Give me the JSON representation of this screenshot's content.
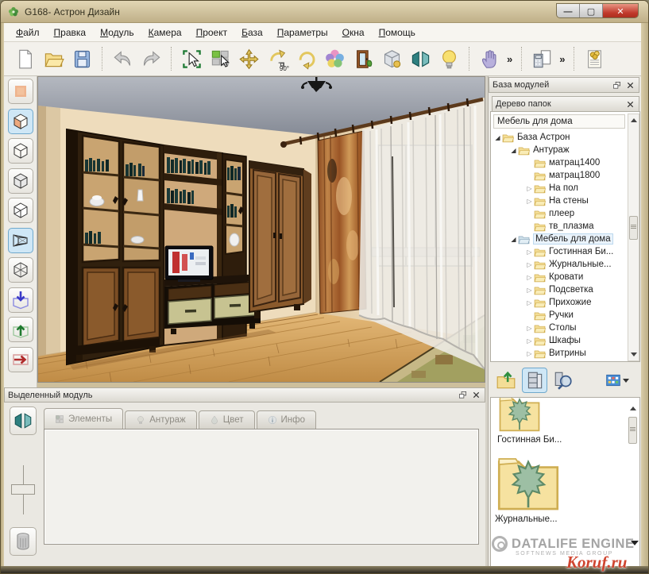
{
  "window": {
    "title": "G168- Астрон Дизайн",
    "app_icon": "astron-flower-icon",
    "controls": [
      "minimize",
      "maximize",
      "close"
    ]
  },
  "menu": {
    "items": [
      "Файл",
      "Правка",
      "Модуль",
      "Камера",
      "Проект",
      "База",
      "Параметры",
      "Окна",
      "Помощь"
    ]
  },
  "main_toolbar": {
    "rotate90_label": "90°",
    "groups": [
      [
        "new-document",
        "open-folder",
        "save-file"
      ],
      [
        "undo",
        "redo"
      ],
      [
        "select",
        "multi-select",
        "move",
        "rotate-90",
        "rotate-free",
        "colors",
        "material-door",
        "texture",
        "mirror-view",
        "light"
      ],
      [
        "pan-hand",
        "»"
      ],
      [
        "calculator-report",
        "»"
      ],
      [
        "estimate"
      ]
    ]
  },
  "left_toolbar": {
    "buttons": [
      {
        "icon": "flat-view",
        "selected": false
      },
      {
        "icon": "solid-view",
        "selected": true
      },
      {
        "icon": "white-view",
        "selected": false
      },
      {
        "icon": "shaded-view",
        "selected": false
      },
      {
        "icon": "open-view",
        "selected": false
      },
      {
        "icon": "perspective-view",
        "selected": true
      },
      {
        "icon": "wireframe-view",
        "selected": false
      },
      {
        "icon": "import-module",
        "selected": false
      },
      {
        "icon": "export-up",
        "selected": false
      },
      {
        "icon": "export-right",
        "selected": false
      }
    ]
  },
  "right_panel": {
    "base_header": "База модулей",
    "tree_header": "Дерево папок",
    "db_name": "Мебель для дома",
    "tree": [
      {
        "label": "База Астрон",
        "level": 1,
        "state": "expanded",
        "selected": false
      },
      {
        "label": "Антураж",
        "level": 2,
        "state": "expanded",
        "selected": false
      },
      {
        "label": "матрац1400",
        "level": 3,
        "state": "none",
        "selected": false
      },
      {
        "label": "матрац1800",
        "level": 3,
        "state": "none",
        "selected": false
      },
      {
        "label": "На пол",
        "level": 3,
        "state": "collapsed",
        "selected": false
      },
      {
        "label": "На стены",
        "level": 3,
        "state": "collapsed",
        "selected": false
      },
      {
        "label": "плеер",
        "level": 3,
        "state": "none",
        "selected": false
      },
      {
        "label": "тв_плазма",
        "level": 3,
        "state": "none",
        "selected": false
      },
      {
        "label": "Мебель для дома",
        "level": 2,
        "state": "expanded",
        "selected": true
      },
      {
        "label": "Гостинная Би...",
        "level": 3,
        "state": "collapsed",
        "selected": false
      },
      {
        "label": "Журнальные...",
        "level": 3,
        "state": "collapsed",
        "selected": false
      },
      {
        "label": "Кровати",
        "level": 3,
        "state": "collapsed",
        "selected": false
      },
      {
        "label": "Подсветка",
        "level": 3,
        "state": "collapsed",
        "selected": false
      },
      {
        "label": "Прихожие",
        "level": 3,
        "state": "collapsed",
        "selected": false
      },
      {
        "label": "Ручки",
        "level": 3,
        "state": "none",
        "selected": false
      },
      {
        "label": "Столы",
        "level": 3,
        "state": "collapsed",
        "selected": false
      },
      {
        "label": "Шкафы",
        "level": 3,
        "state": "collapsed",
        "selected": false
      },
      {
        "label": "Витрины",
        "level": 3,
        "state": "collapsed",
        "selected": false
      }
    ],
    "tools": [
      {
        "icon": "folder-up",
        "selected": false
      },
      {
        "icon": "modules-view",
        "selected": true
      },
      {
        "icon": "module-search",
        "selected": false
      },
      {
        "icon": "grid-view",
        "selected": false,
        "caret": true
      }
    ],
    "thumbnails": [
      {
        "icon": "folder-leaf-icon",
        "label": "Гостинная Би..."
      },
      {
        "icon": "folder-leaf-icon",
        "label": "Журнальные..."
      }
    ]
  },
  "bottom_panel": {
    "title": "Выделенный модуль",
    "tabs": [
      {
        "icon": "elements",
        "label": "Элементы"
      },
      {
        "icon": "decor",
        "label": "Антураж"
      },
      {
        "icon": "color",
        "label": "Цвет"
      },
      {
        "icon": "info",
        "label": "Инфо"
      }
    ],
    "side_tools": [
      "mirror-button",
      "scale-slider",
      "delete-trash-button"
    ]
  },
  "watermark": {
    "brand": "DATALIFE ENGINE",
    "sub": "SOFTNEWS MEDIA GROUP",
    "site": "Koruf.ru"
  },
  "colors": {
    "frame": "#cdbf9c",
    "selection_blue": "#cfe7f6",
    "close_red": "#c0392b",
    "wall": "#ecd8b6",
    "floor": "#d9a75f",
    "wood_dark": "#30200e",
    "wood_mid": "#8a5a2c",
    "drawer_green": "#c7c391",
    "watermark_red": "#cf4530"
  }
}
